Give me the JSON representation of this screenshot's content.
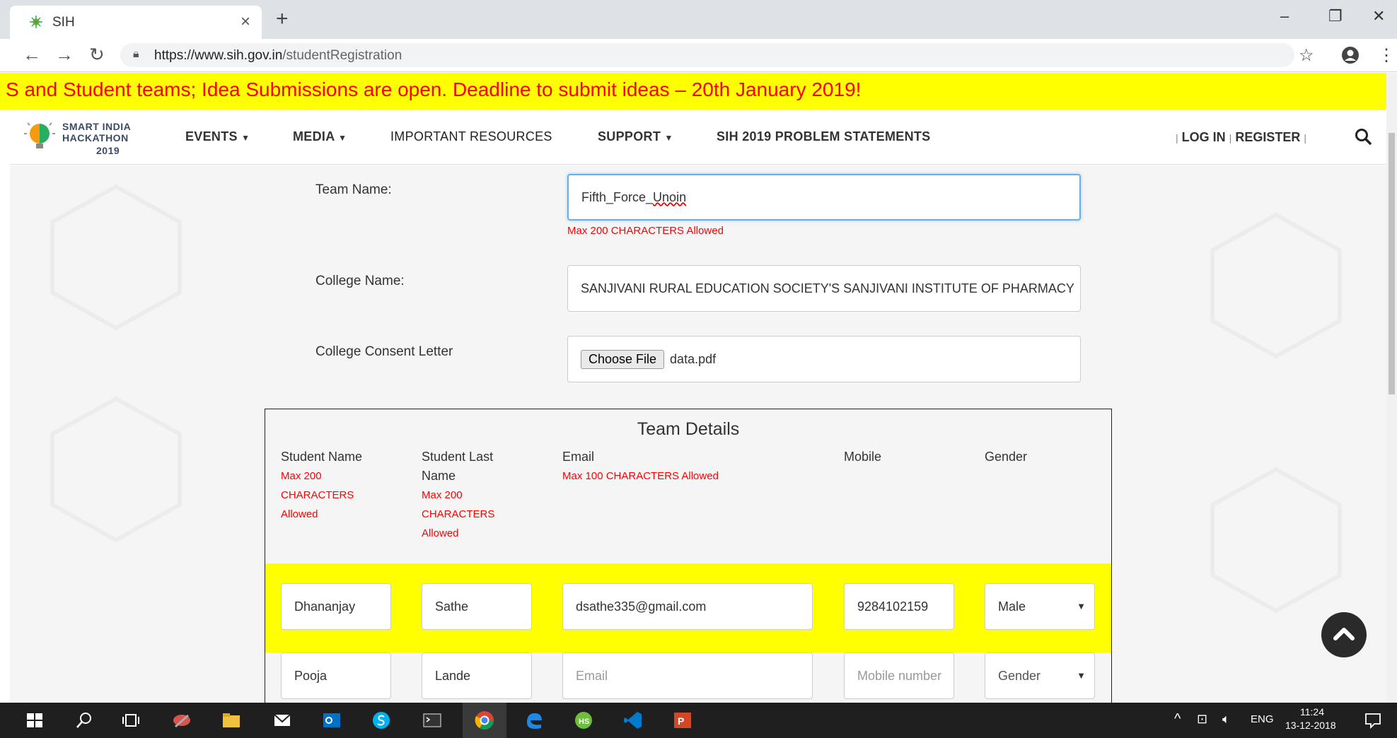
{
  "browser": {
    "tab_title": "SIH",
    "url_host": "https://www.sih.gov.in",
    "url_path": "/studentRegistration"
  },
  "marquee": {
    "text": "S and Student teams; Idea Submissions are open. Deadline to submit ideas – 20th January 2019!"
  },
  "header": {
    "logo_line1": "SMART INDIA",
    "logo_line2": "HACKATHON",
    "logo_line3": "2019",
    "nav": [
      {
        "label": "EVENTS",
        "dropdown": true
      },
      {
        "label": "MEDIA",
        "dropdown": true
      },
      {
        "label": "IMPORTANT RESOURCES",
        "dropdown": false
      },
      {
        "label": "SUPPORT",
        "dropdown": true
      },
      {
        "label": "SIH 2019 PROBLEM STATEMENTS",
        "dropdown": false
      }
    ],
    "login": "LOG IN",
    "register": "REGISTER",
    "sep": "|"
  },
  "form": {
    "team_name_label": "Team Name:",
    "team_name_value_part1": "Fifth_Force_",
    "team_name_value_part2": "Unoin",
    "team_name_hint": "Max 200 CHARACTERS Allowed",
    "college_name_label": "College Name:",
    "college_name_value": "SANJIVANI RURAL EDUCATION SOCIETY'S SANJIVANI INSTITUTE OF PHARMACY",
    "consent_label": "College Consent Letter",
    "consent_button": "Choose File",
    "consent_file": "data.pdf"
  },
  "team": {
    "title": "Team Details",
    "columns": {
      "student_name": "Student Name",
      "student_name_hint": "Max 200 CHARACTERS Allowed",
      "last_name_1": "Student Last",
      "last_name_2": "Name",
      "last_name_hint": "Max 200 CHARACTERS Allowed",
      "email": "Email",
      "email_hint": "Max 100 CHARACTERS Allowed",
      "mobile": "Mobile",
      "gender": "Gender"
    },
    "rows": [
      {
        "first": "Dhananjay",
        "last": "Sathe",
        "email": "dsathe335@gmail.com",
        "mobile": "9284102159",
        "gender": "Male"
      },
      {
        "first": "Pooja",
        "last": "Lande",
        "email_placeholder": "Email",
        "mobile_placeholder": "Mobile number",
        "gender_placeholder": "Gender"
      }
    ]
  },
  "taskbar": {
    "lang": "ENG",
    "time": "11:24",
    "date": "13-12-2018"
  },
  "colors": {
    "marquee_bg": "#ffff00",
    "marquee_text": "#ff0000",
    "hint": "#ff0000",
    "focus_border": "#66afe9"
  }
}
